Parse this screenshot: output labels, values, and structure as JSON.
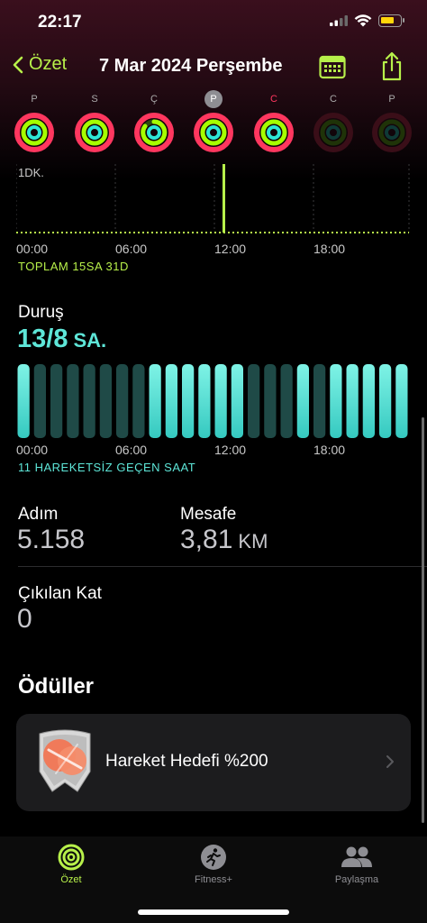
{
  "status_bar": {
    "time": "22:17"
  },
  "nav": {
    "back_label": "Özet",
    "title": "7 Mar 2024 Perşembe"
  },
  "week": {
    "days": [
      {
        "label": "P"
      },
      {
        "label": "S"
      },
      {
        "label": "Ç"
      },
      {
        "label": "P"
      },
      {
        "label": "C"
      },
      {
        "label": "C"
      },
      {
        "label": "P"
      }
    ]
  },
  "exercise": {
    "scale_label": "1DK.",
    "time_axis": [
      "00:00",
      "06:00",
      "12:00",
      "18:00"
    ],
    "total": "TOPLAM 15SA 31D"
  },
  "stand": {
    "title": "Duruş",
    "value": "13/8",
    "unit": "SA.",
    "time_axis": [
      "00:00",
      "06:00",
      "12:00",
      "18:00"
    ],
    "summary": "11 HAREKETSİZ GEÇEN SAAT",
    "hours_stood": [
      1,
      0,
      0,
      0,
      0,
      0,
      0,
      0,
      1,
      1,
      1,
      1,
      1,
      1,
      0,
      0,
      0,
      1,
      0,
      1,
      1,
      1,
      1,
      1
    ]
  },
  "metrics": {
    "steps_label": "Adım",
    "steps_value": "5.158",
    "distance_label": "Mesafe",
    "distance_value": "3,81",
    "distance_unit": "KM",
    "floors_label": "Çıkılan Kat",
    "floors_value": "0"
  },
  "awards": {
    "title": "Ödüller",
    "items": [
      {
        "label": "Hareket Hedefi %200"
      }
    ]
  },
  "tabbar": {
    "tabs": [
      {
        "label": "Özet"
      },
      {
        "label": "Fitness+"
      },
      {
        "label": "Paylaşma"
      }
    ]
  },
  "colors": {
    "accent_green": "#b7f04a",
    "stand_cyan": "#5ee6d8",
    "move_red": "#ff375f"
  }
}
